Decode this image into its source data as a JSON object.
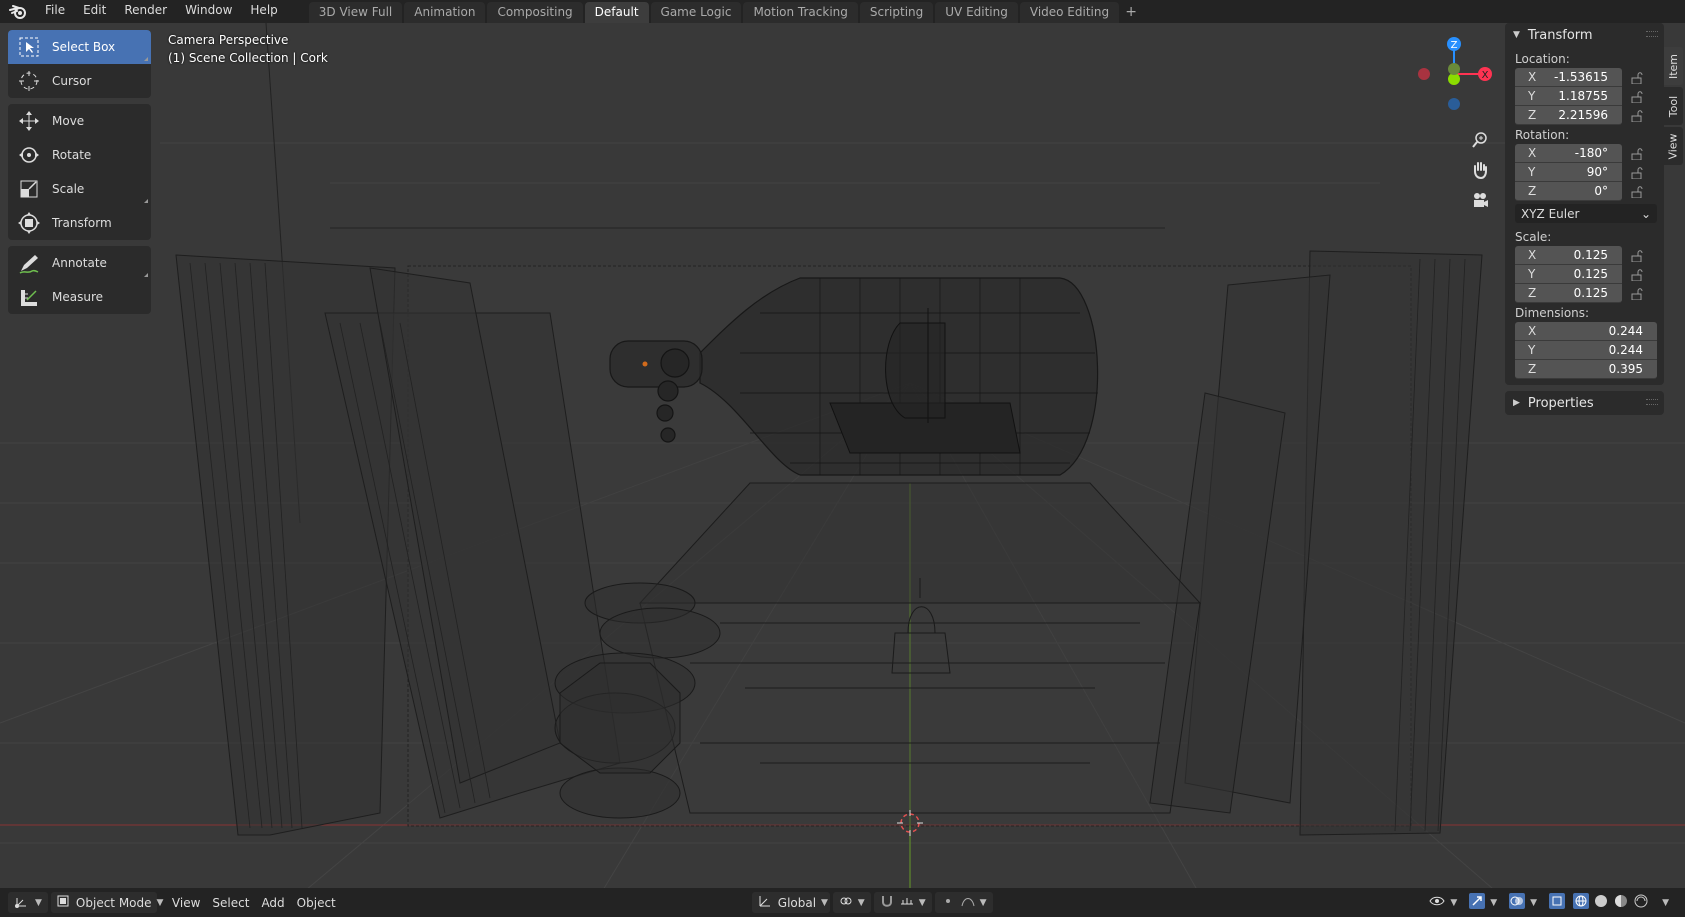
{
  "topbar": {
    "logo_icon": "blender-logo-icon",
    "menus": [
      "File",
      "Edit",
      "Render",
      "Window",
      "Help"
    ],
    "workspace_tabs": [
      "3D View Full",
      "Animation",
      "Compositing",
      "Default",
      "Game Logic",
      "Motion Tracking",
      "Scripting",
      "UV Editing",
      "Video Editing"
    ],
    "active_tab": "Default",
    "add_tab_label": "+"
  },
  "toolbar": {
    "groups": [
      [
        {
          "label": "Select Box",
          "icon": "select-box-icon",
          "active": true
        },
        {
          "label": "Cursor",
          "icon": "cursor-icon"
        }
      ],
      [
        {
          "label": "Move",
          "icon": "move-icon"
        },
        {
          "label": "Rotate",
          "icon": "rotate-icon"
        },
        {
          "label": "Scale",
          "icon": "scale-icon"
        },
        {
          "label": "Transform",
          "icon": "transform-icon"
        }
      ],
      [
        {
          "label": "Annotate",
          "icon": "annotate-icon"
        },
        {
          "label": "Measure",
          "icon": "measure-icon"
        }
      ]
    ]
  },
  "viewport": {
    "view_name": "Camera Perspective",
    "collection_info": "(1) Scene Collection | Cork",
    "gizmo_labels": {
      "z": "Z",
      "x": "X"
    }
  },
  "sidepanel": {
    "transform": {
      "title": "Transform",
      "location_label": "Location:",
      "location": [
        {
          "axis": "X",
          "value": "-1.53615"
        },
        {
          "axis": "Y",
          "value": "1.18755"
        },
        {
          "axis": "Z",
          "value": "2.21596"
        }
      ],
      "rotation_label": "Rotation:",
      "rotation": [
        {
          "axis": "X",
          "value": "-180°"
        },
        {
          "axis": "Y",
          "value": "90°"
        },
        {
          "axis": "Z",
          "value": "0°"
        }
      ],
      "rotation_mode": "XYZ Euler",
      "scale_label": "Scale:",
      "scale": [
        {
          "axis": "X",
          "value": "0.125"
        },
        {
          "axis": "Y",
          "value": "0.125"
        },
        {
          "axis": "Z",
          "value": "0.125"
        }
      ],
      "dimensions_label": "Dimensions:",
      "dimensions": [
        {
          "axis": "X",
          "value": "0.244"
        },
        {
          "axis": "Y",
          "value": "0.244"
        },
        {
          "axis": "Z",
          "value": "0.395"
        }
      ]
    },
    "properties": {
      "title": "Properties"
    },
    "tabs": [
      "Item",
      "Tool",
      "View"
    ]
  },
  "bottombar": {
    "mode": "Object Mode",
    "menus": [
      "View",
      "Select",
      "Add",
      "Object"
    ],
    "orientation": "Global"
  },
  "colors": {
    "accent": "#4772b3",
    "axis_x": "#ff3352",
    "axis_y": "#8bdc00",
    "axis_z": "#2890ff"
  }
}
